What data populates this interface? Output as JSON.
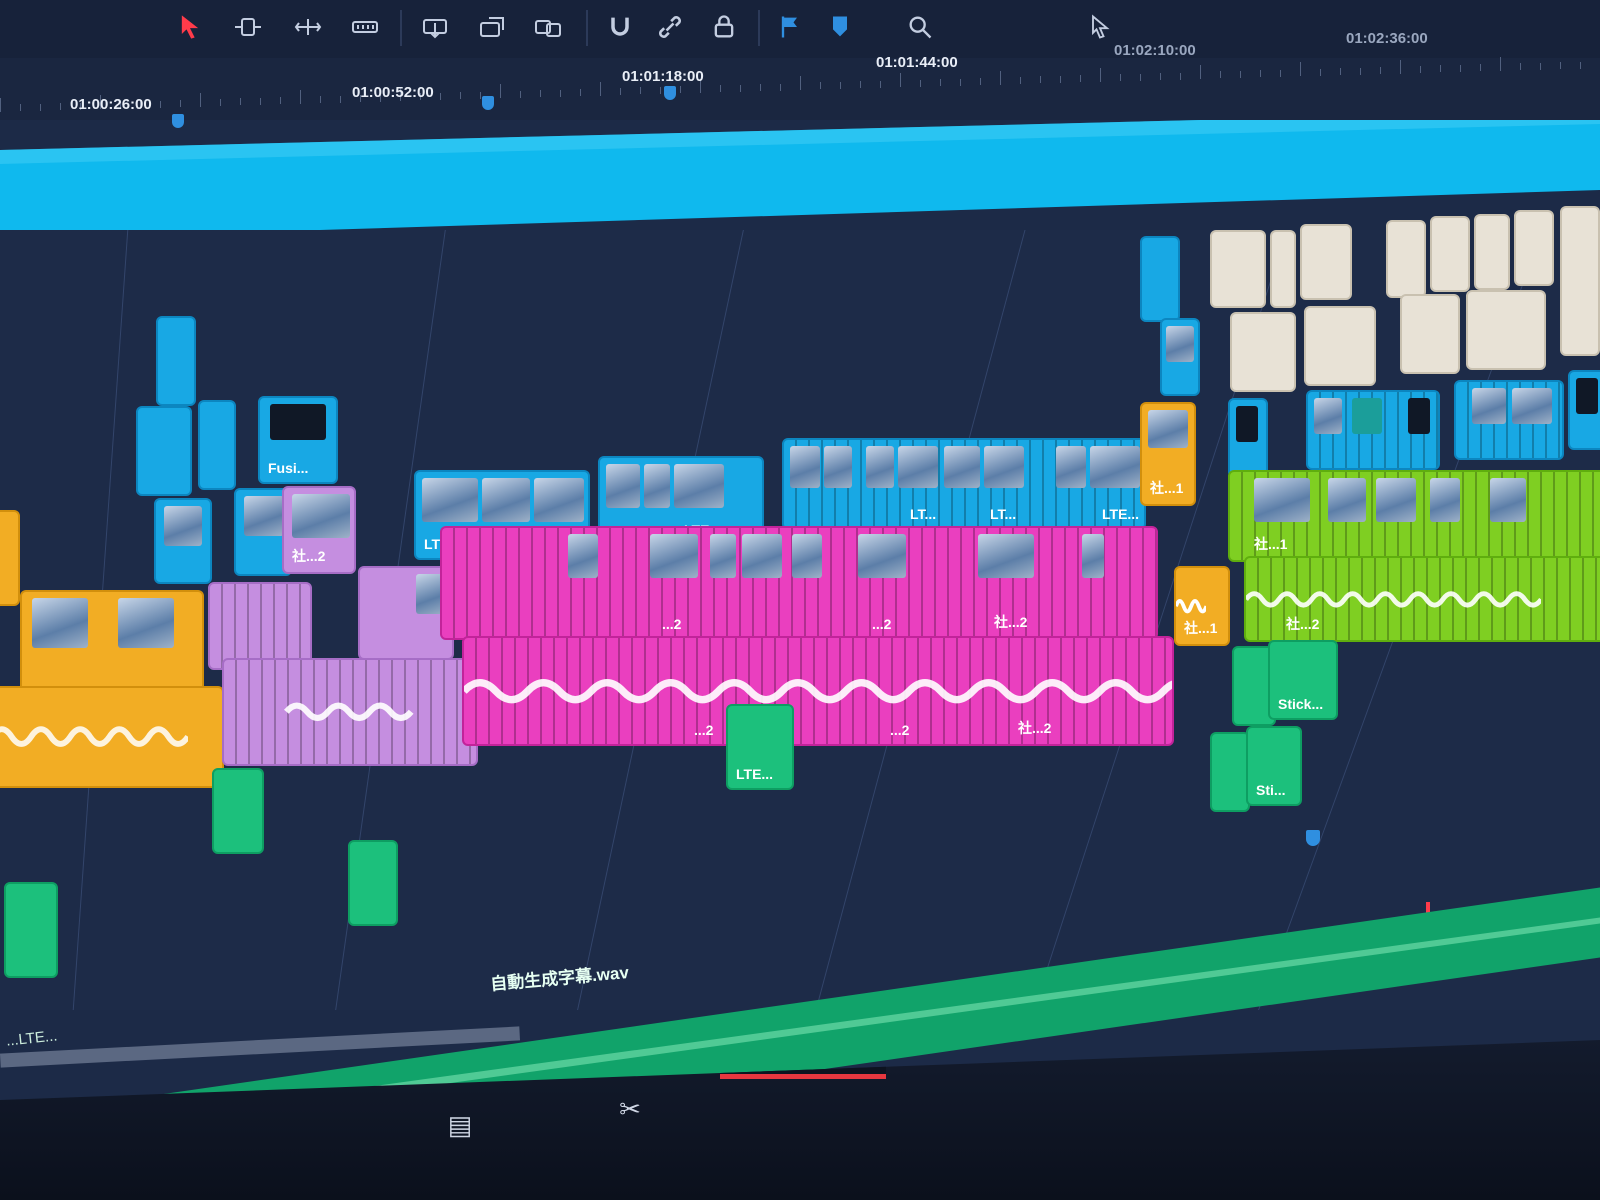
{
  "toolbar": {
    "tools": [
      {
        "name": "selection-arrow-icon",
        "glyph": "➤",
        "active": true
      },
      {
        "name": "trim-edit-icon",
        "glyph": "⇹"
      },
      {
        "name": "dynamic-trim-icon",
        "glyph": "⟺"
      },
      {
        "name": "blade-icon",
        "glyph": "▭"
      },
      {
        "name": "insert-clip-icon",
        "glyph": "⧉"
      },
      {
        "name": "overwrite-clip-icon",
        "glyph": "⧉"
      },
      {
        "name": "replace-clip-icon",
        "glyph": "⇄"
      },
      {
        "name": "snapping-icon",
        "glyph": "∩"
      },
      {
        "name": "linked-selection-icon",
        "glyph": "∞"
      },
      {
        "name": "position-lock-icon",
        "glyph": "⌂"
      },
      {
        "name": "flag-icon",
        "glyph": "⚑"
      },
      {
        "name": "marker-icon",
        "glyph": "◆"
      },
      {
        "name": "zoom-icon",
        "glyph": "⌕"
      }
    ]
  },
  "ruler": {
    "timecodes": [
      "01:00:26:00",
      "01:00:52:00",
      "01:01:18:00",
      "01:01:44:00",
      "01:02:10:00",
      "01:02:36:00"
    ]
  },
  "clips": {
    "v_cyan_a": "Fusi...",
    "v_cyan_b": "LTE...",
    "v_cyan_c": "LT...",
    "v_cyan_d": "LTE...",
    "v_cyan_e": "LTE...",
    "v_cyan_f": "LT...",
    "v_cyan_g": "LT...",
    "v_cyan_h": "LTE...",
    "v_orange_top": "社...1",
    "v_lilac_a": "社...2",
    "v_mag_a": "...2",
    "v_mag_b": "...2",
    "v_mag_c": "社...2",
    "a_mag_a": "...2",
    "a_mag_b": "...2",
    "a_mag_c": "社...2",
    "a_orange": "社...1",
    "v_lime": "社...1",
    "a_lime": "社...2",
    "a_teal_a": "LTE...",
    "a_teal_b": "Stick...",
    "a_teal_c": "Sti..."
  },
  "green_track": {
    "label": "自動生成字幕.wav",
    "label_left": "...LTE..."
  },
  "pages": [
    {
      "name": "media-page-icon",
      "glyph": "▤"
    },
    {
      "name": "cut-page-icon",
      "glyph": "✂"
    },
    {
      "name": "edit-page-icon",
      "glyph": "❖",
      "active": true
    },
    {
      "name": "fusion-page-icon",
      "glyph": "✦"
    },
    {
      "name": "color-page-icon",
      "glyph": "✺"
    },
    {
      "name": "fairlight-page-icon",
      "glyph": "♫"
    },
    {
      "name": "deliver-page-icon",
      "glyph": "🚀"
    }
  ],
  "colors": {
    "cyan": "#18a8e4",
    "magenta": "#ea3fbf",
    "lilac": "#c58ee0",
    "orange": "#f2ad24",
    "lime": "#7fcf22",
    "teal": "#1cc07c",
    "cream": "#e8e2d6",
    "playhead": "#ff3b4a"
  }
}
